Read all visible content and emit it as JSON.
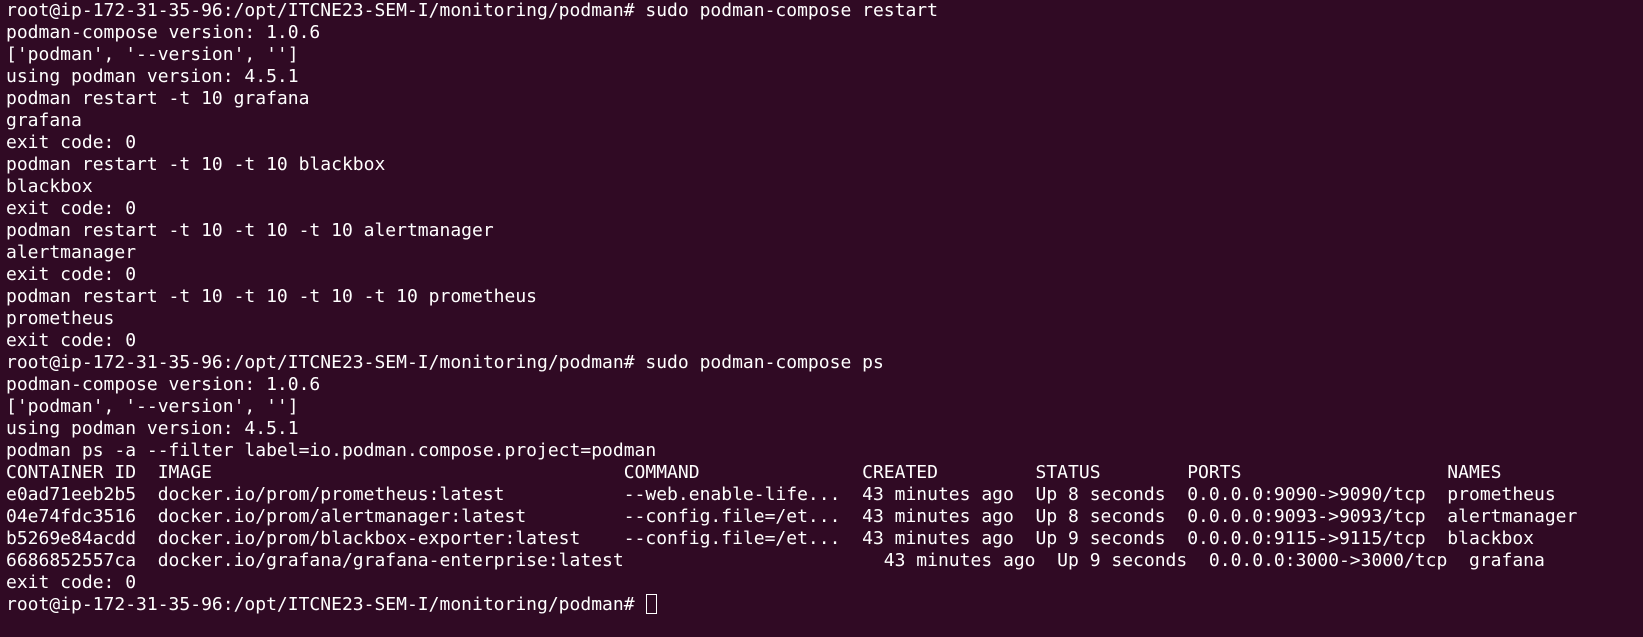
{
  "terminal": {
    "lines": [
      "root@ip-172-31-35-96:/opt/ITCNE23-SEM-I/monitoring/podman# sudo podman-compose restart",
      "podman-compose version: 1.0.6",
      "['podman', '--version', '']",
      "using podman version: 4.5.1",
      "podman restart -t 10 grafana",
      "grafana",
      "exit code: 0",
      "podman restart -t 10 -t 10 blackbox",
      "blackbox",
      "exit code: 0",
      "podman restart -t 10 -t 10 -t 10 alertmanager",
      "alertmanager",
      "exit code: 0",
      "podman restart -t 10 -t 10 -t 10 -t 10 prometheus",
      "prometheus",
      "exit code: 0",
      "root@ip-172-31-35-96:/opt/ITCNE23-SEM-I/monitoring/podman# sudo podman-compose ps",
      "podman-compose version: 1.0.6",
      "['podman', '--version', '']",
      "using podman version: 4.5.1",
      "podman ps -a --filter label=io.podman.compose.project=podman",
      "CONTAINER ID  IMAGE                                      COMMAND               CREATED         STATUS        PORTS                   NAMES",
      "e0ad71eeb2b5  docker.io/prom/prometheus:latest           --web.enable-life...  43 minutes ago  Up 8 seconds  0.0.0.0:9090->9090/tcp  prometheus",
      "04e74fdc3516  docker.io/prom/alertmanager:latest         --config.file=/et...  43 minutes ago  Up 8 seconds  0.0.0.0:9093->9093/tcp  alertmanager",
      "b5269e84acdd  docker.io/prom/blackbox-exporter:latest    --config.file=/et...  43 minutes ago  Up 9 seconds  0.0.0.0:9115->9115/tcp  blackbox",
      "6686852557ca  docker.io/grafana/grafana-enterprise:latest                        43 minutes ago  Up 9 seconds  0.0.0.0:3000->3000/tcp  grafana",
      "exit code: 0"
    ],
    "prompt": "root@ip-172-31-35-96:/opt/ITCNE23-SEM-I/monitoring/podman#"
  },
  "colors": {
    "background": "#300a24",
    "foreground": "#ffffff"
  }
}
